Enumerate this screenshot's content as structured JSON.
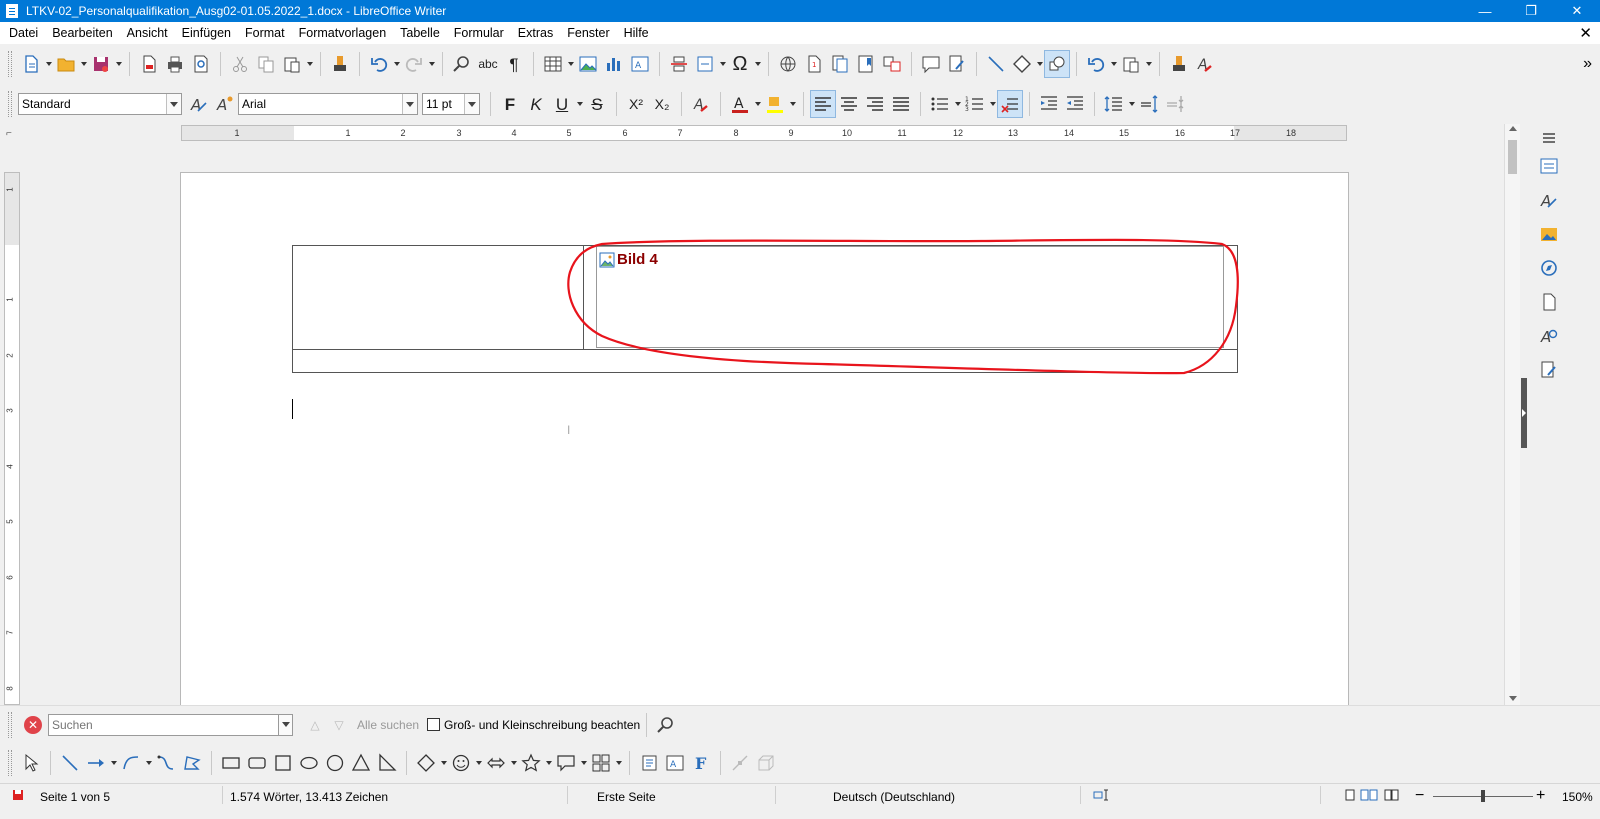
{
  "window": {
    "title": "LTKV-02_Personalqualifikation_Ausg02-01.05.2022_1.docx - LibreOffice Writer",
    "minimize": "—",
    "restore": "❐",
    "close": "✕"
  },
  "menu": {
    "items": [
      "Datei",
      "Bearbeiten",
      "Ansicht",
      "Einfügen",
      "Format",
      "Formatvorlagen",
      "Tabelle",
      "Formular",
      "Extras",
      "Fenster",
      "Hilfe"
    ],
    "close_doc": "✕"
  },
  "formatting": {
    "paragraph_style": "Standard",
    "font_name": "Arial",
    "font_size": "11 pt",
    "bold": "F",
    "italic": "K",
    "underline": "U",
    "strike": "S",
    "superscript": "X²",
    "subscript": "X₂"
  },
  "ruler": {
    "h_ticks": [
      "1",
      "1",
      "2",
      "3",
      "4",
      "5",
      "6",
      "7",
      "8",
      "9",
      "10",
      "11",
      "12",
      "13",
      "14",
      "15",
      "16",
      "17",
      "18"
    ],
    "v_ticks": [
      "1",
      "1",
      "2",
      "3",
      "4",
      "5",
      "6",
      "7",
      "8"
    ],
    "corner": "⌐"
  },
  "document": {
    "image_label": "Bild 4",
    "ibeam": "I"
  },
  "findbar": {
    "placeholder": "Suchen",
    "find_all": "Alle suchen",
    "match_case": "Groß- und Kleinschreibung beachten",
    "close": "✕"
  },
  "status": {
    "page": "Seite 1 von 5",
    "words": "1.574 Wörter, 13.413 Zeichen",
    "page_style": "Erste Seite",
    "language": "Deutsch (Deutschland)",
    "zoom": "150%",
    "zoom_minus": "−",
    "zoom_plus": "+"
  },
  "colors": {
    "titlebar": "#0078d7",
    "annotation": "#e8141c",
    "image_label": "#8b0000"
  }
}
